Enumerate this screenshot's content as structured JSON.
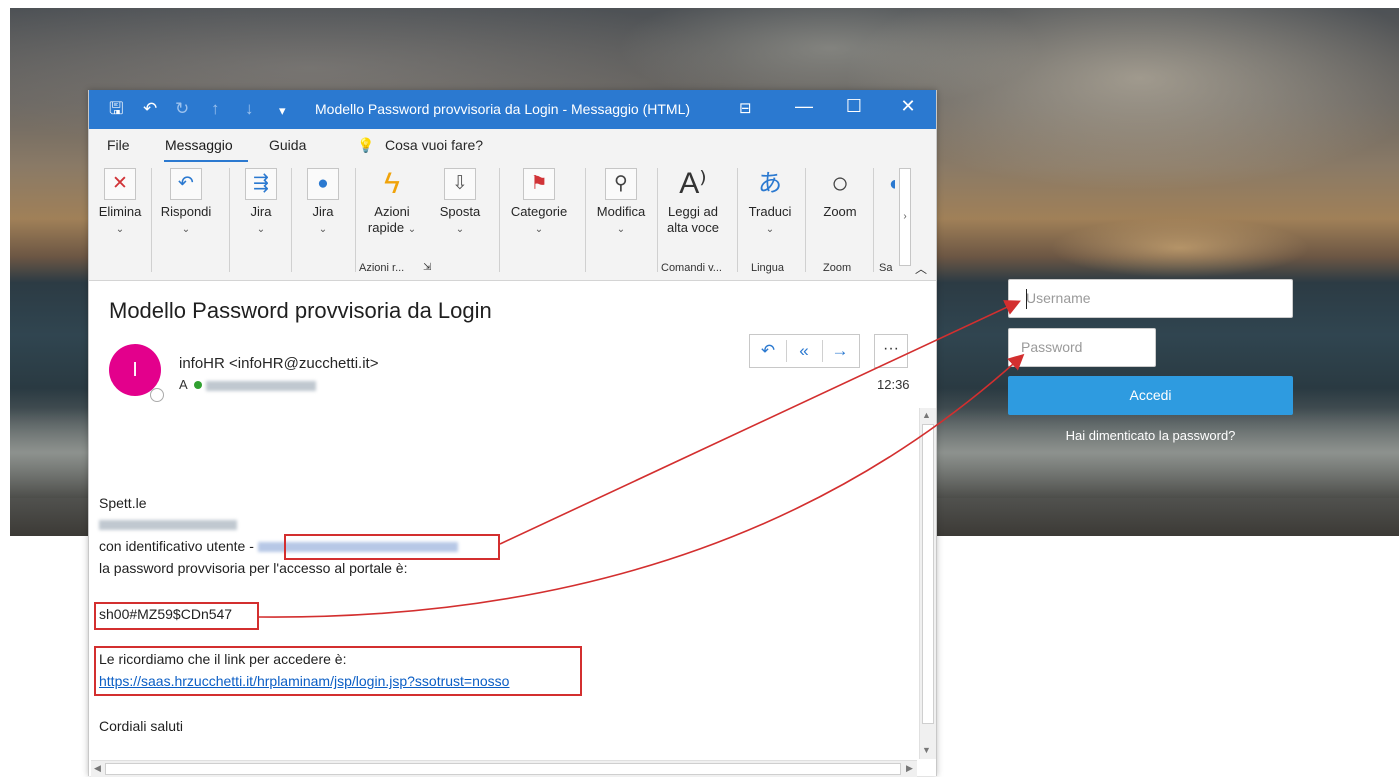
{
  "window": {
    "title": "Modello Password provvisoria da Login  -  Messaggio (HTML)",
    "controls": {
      "minimize": "—",
      "maximize": "☐",
      "close": "✕"
    }
  },
  "menu": {
    "file": "File",
    "messaggio": "Messaggio",
    "guida": "Guida",
    "search": "Cosa vuoi fare?"
  },
  "ribbon": {
    "elimina": "Elimina",
    "rispondi": "Rispondi",
    "jira1": "Jira",
    "jira2": "Jira",
    "azioni_1": "Azioni",
    "azioni_2": "rapide",
    "sposta": "Sposta",
    "categorie": "Categorie",
    "modifica": "Modifica",
    "leggi_1": "Leggi ad",
    "leggi_2": "alta voce",
    "traduci": "Traduci",
    "zoom": "Zoom",
    "groups": {
      "azioni": "Azioni r...",
      "comandi": "Comandi v...",
      "lingua": "Lingua",
      "zoom": "Zoom",
      "sa": "Sa"
    }
  },
  "message": {
    "subject": "Modello Password provvisoria da Login",
    "avatar_letter": "I",
    "sender": "infoHR <infoHR@zucchetti.it>",
    "to_prefix": "A",
    "time": "12:36",
    "greeting": "Spett.le",
    "id_line": "con identificativo utente -",
    "pw_line": "la password provvisoria per l'accesso al portale è:",
    "password": "sh00#MZ59$CDn547",
    "link_intro": "Le ricordiamo che il link per accedere è:",
    "link": "https://saas.hrzucchetti.it/hrplaminam/jsp/login.jsp?ssotrust=nosso",
    "closing": "Cordiali saluti"
  },
  "login": {
    "username_placeholder": "Username",
    "password_placeholder": "Password",
    "submit": "Accedi",
    "forgot": "Hai dimenticato la password?"
  },
  "colors": {
    "outlook_blue": "#2b79d0",
    "avatar": "#e3008c",
    "highlight_red": "#d32f2f",
    "login_button": "#2e9be0"
  }
}
